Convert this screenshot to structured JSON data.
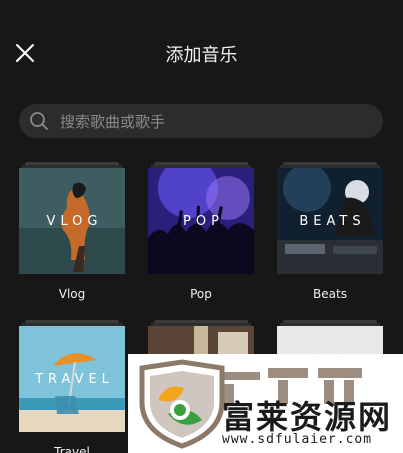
{
  "header": {
    "close_icon": "close-icon",
    "title": "添加音乐"
  },
  "search": {
    "icon": "search-icon",
    "placeholder": "搜索歌曲或歌手"
  },
  "categories": [
    {
      "label": "Vlog",
      "overlay": "VLOG"
    },
    {
      "label": "Pop",
      "overlay": "POP"
    },
    {
      "label": "Beats",
      "overlay": "BEATS"
    },
    {
      "label": "Travel",
      "overlay": "TRAVEL"
    },
    {
      "label": "",
      "overlay": ""
    },
    {
      "label": "",
      "overlay": ""
    }
  ],
  "watermark": {
    "brand": "富莱资源网",
    "url": "www.sdfulaier.com",
    "logo": "leaf-logo-icon"
  },
  "colors": {
    "background": "#171717",
    "search_bg": "#2c2c2c",
    "placeholder": "#8a8a8a",
    "text": "#ffffff"
  }
}
